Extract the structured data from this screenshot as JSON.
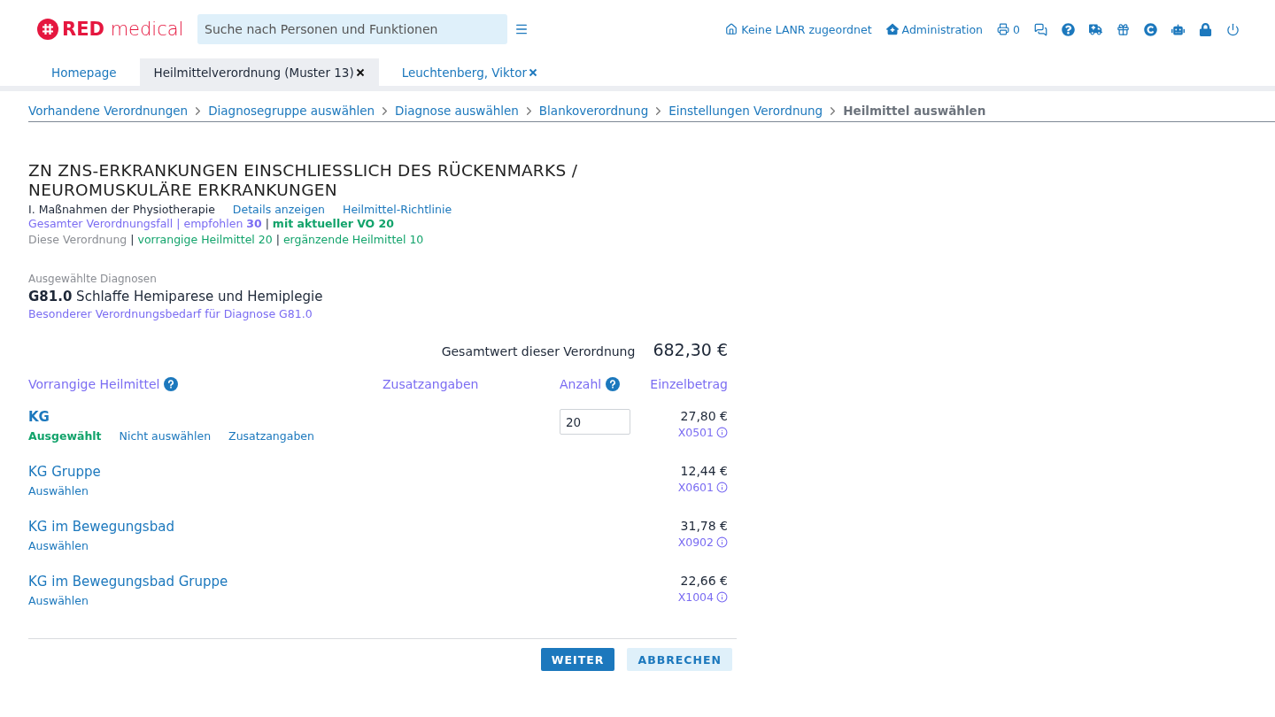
{
  "logo": {
    "bold": "RED",
    "light": "medical"
  },
  "search": {
    "placeholder": "Suche nach Personen und Funktionen"
  },
  "header_links": [
    {
      "kind": "home",
      "label": "Keine LANR zugeordnet"
    },
    {
      "kind": "admin",
      "label": "Administration"
    },
    {
      "kind": "printer",
      "label": "0"
    }
  ],
  "header_icons": [
    {
      "kind": "chat"
    },
    {
      "kind": "help"
    },
    {
      "kind": "truck"
    },
    {
      "kind": "gift"
    },
    {
      "kind": "copyright"
    },
    {
      "kind": "robot"
    },
    {
      "kind": "lock"
    },
    {
      "kind": "power"
    }
  ],
  "tabs": [
    {
      "label": "Homepage",
      "selected": false,
      "closable": false
    },
    {
      "label": "Heilmittelverordnung (Muster 13)",
      "selected": true,
      "closable": true
    },
    {
      "label": "Leuchtenberg, Viktor",
      "selected": false,
      "closable": true
    }
  ],
  "breadcrumb": [
    {
      "label": "Vorhandene Verordnungen",
      "current": false
    },
    {
      "label": "Diagnosegruppe auswählen",
      "current": false
    },
    {
      "label": "Diagnose auswählen",
      "current": false
    },
    {
      "label": "Blankoverordnung",
      "current": false
    },
    {
      "label": "Einstellungen Verordnung",
      "current": false
    },
    {
      "label": "Heilmittel auswählen",
      "current": true
    }
  ],
  "title": "ZN ZNS-ERKRANKUNGEN EINSCHLIESSLICH DES RÜCKENMARKS / NEUROMUSKULÄRE ERKRANKUNGEN",
  "subtitle": {
    "text": "I. Maßnahmen der Physiotherapie",
    "links": [
      "Details anzeigen",
      "Heilmittel-Richtlinie"
    ]
  },
  "summary_lines": [
    [
      {
        "text": "Gesamter Verordnungsfall | empfohlen **30**",
        "color": "#7a6cf2"
      },
      {
        "text": " | "
      },
      {
        "text": "**mit aktueller VO 20**",
        "color": "#12a36b"
      }
    ],
    [
      {
        "text": "Diese Verordnung",
        "color": "#8a8d93"
      },
      {
        "text": " | "
      },
      {
        "text": "vorrangige Heilmittel 20",
        "color": "#12a36b"
      },
      {
        "text": " | "
      },
      {
        "text": "ergänzende Heilmittel 10",
        "color": "#12a36b"
      }
    ]
  ],
  "diagnoses": {
    "label": "Ausgewählte Diagnosen",
    "entries": [
      {
        "code": "G81.0",
        "text": "Schlaffe Hemiparese und Hemiplegie",
        "note": "Besonderer Verordnungsbedarf für Diagnose G81.0"
      }
    ]
  },
  "total": {
    "label": "Gesamtwert dieser Verordnung",
    "value": "682,30 €"
  },
  "columns": [
    "Vorrangige Heilmittel",
    "Zusatzangaben",
    "Anzahl",
    "Einzelbetrag"
  ],
  "remedies": [
    {
      "name": "KG",
      "selected": true,
      "actions": [
        {
          "label": "Ausgewählt",
          "kind": "status"
        },
        {
          "label": "Nicht auswählen",
          "kind": "link"
        },
        {
          "label": "Zusatzangaben",
          "kind": "link"
        }
      ],
      "quantity": "20",
      "price": "27,80 €",
      "code": "X0501"
    },
    {
      "name": "KG Gruppe",
      "selected": false,
      "actions": [
        {
          "label": "Auswählen",
          "kind": "link"
        }
      ],
      "price": "12,44 €",
      "code": "X0601"
    },
    {
      "name": "KG im Bewegungsbad",
      "selected": false,
      "actions": [
        {
          "label": "Auswählen",
          "kind": "link"
        }
      ],
      "price": "31,78 €",
      "code": "X0902"
    },
    {
      "name": "KG im Bewegungsbad Gruppe",
      "selected": false,
      "actions": [
        {
          "label": "Auswählen",
          "kind": "link"
        }
      ],
      "price": "22,66 €",
      "code": "X1004"
    }
  ],
  "buttons": [
    {
      "label": "WEITER",
      "kind": "primary"
    },
    {
      "label": "ABBRECHEN",
      "kind": "secondary"
    }
  ]
}
